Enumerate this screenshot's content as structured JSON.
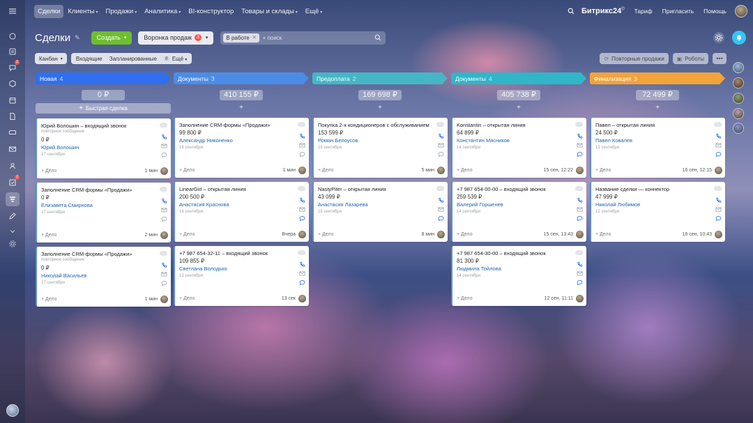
{
  "topnav": {
    "items": [
      {
        "label": "Сделки",
        "active": true,
        "caret": false
      },
      {
        "label": "Клиенты",
        "active": false,
        "caret": true
      },
      {
        "label": "Продажи",
        "active": false,
        "caret": true
      },
      {
        "label": "Аналитика",
        "active": false,
        "caret": true
      },
      {
        "label": "BI-конструктор",
        "active": false,
        "caret": false
      },
      {
        "label": "Товары и склады",
        "active": false,
        "caret": true
      },
      {
        "label": "Ещё",
        "active": false,
        "caret": true
      }
    ],
    "brand": "Битрикс24",
    "brand_mark": "©",
    "tariff": "Тариф",
    "invite": "Пригласить",
    "help": "Помощь"
  },
  "sidebar": {
    "badges": {
      "chat": "2",
      "tasks": "2"
    }
  },
  "header": {
    "title": "Сделки",
    "create_label": "Создать",
    "funnel_label": "Воронка продаж",
    "funnel_count": "3",
    "filter_chip": "В работе",
    "search_placeholder": "+ поиск"
  },
  "view": {
    "mode": "Канбан",
    "incoming": "Входящие",
    "planned": "Запланированные",
    "more_count": "8",
    "more_label": "Ещё",
    "repeat_sales": "Повторные продажи",
    "robots": "Роботы",
    "dots": "•••"
  },
  "deal_label": "+ Дело",
  "quick_deal": "Быстрая сделка",
  "columns": [
    {
      "name": "Новая",
      "count": "4",
      "sum": "0 ₽",
      "color": "#2f6ff0",
      "cards": [
        {
          "title": "Юрий Волошин – входящий звонок",
          "sub": "повторное сообщение",
          "amount": "0 ₽",
          "client": "Юрий Волошин",
          "date": "17 сентября",
          "time": "1 мин"
        },
        {
          "title": "Заполнение CRM-формы «Продажи»",
          "sub": "",
          "amount": "0 ₽",
          "client": "Елизавета Смирнова",
          "date": "17 сентября",
          "time": "2 мин"
        },
        {
          "title": "Заполнение CRM-формы «Продажи»",
          "sub": "повторное сообщение",
          "amount": "0 ₽",
          "client": "Николай Васильев",
          "date": "17 сентября",
          "time": "1 мин"
        }
      ]
    },
    {
      "name": "Документы",
      "count": "3",
      "sum": "410 155 ₽",
      "color": "#4b8de6",
      "cards": [
        {
          "title": "Заполнение CRM-формы «Продажи»",
          "sub": "",
          "amount": "99 800 ₽",
          "client": "Александр Никоненко",
          "date": "16 сентября",
          "time": "1 мин"
        },
        {
          "title": "LinearGirl – открытая линия",
          "sub": "",
          "amount": "200 500 ₽",
          "client": "Анастасия Краснова",
          "date": "16 сентября",
          "time": "Вчера"
        },
        {
          "title": "+7 987 654-32-11 – входящий звонок",
          "sub": "",
          "amount": "109 855 ₽",
          "client": "Светлана Володько",
          "date": "13 сентября",
          "time": "13 сек"
        }
      ]
    },
    {
      "name": "Предоплата",
      "count": "2",
      "sum": "169 698 ₽",
      "color": "#46b6c6",
      "cards": [
        {
          "title": "Покупка 2-х кондиционеров с обслуживанием",
          "sub": "",
          "amount": "153 599 ₽",
          "client": "Роман Белоусов",
          "date": "15 сентября",
          "time": "5 мин"
        },
        {
          "title": "NastyPiter – открытая линия",
          "sub": "",
          "amount": "43 099 ₽",
          "client": "Анастасия Лазарева",
          "date": "15 сентября",
          "time": "8 мин"
        }
      ]
    },
    {
      "name": "Документы",
      "count": "4",
      "sum": "405 738 ₽",
      "color": "#2fb6c8",
      "cards": [
        {
          "title": "Konstantin – открытая линия",
          "sub": "",
          "amount": "64 899 ₽",
          "client": "Константин Мясников",
          "date": "14 сентября",
          "time": "15 сен, 12:22"
        },
        {
          "title": "+7 987 654-00-00 – входящий звонок",
          "sub": "",
          "amount": "259 539 ₽",
          "client": "Валерий Горшенев",
          "date": "14 сентября",
          "time": "15 сен, 13:43"
        },
        {
          "title": "+7 987 654-30-00 – входящий звонок",
          "sub": "",
          "amount": "81 300 ₽",
          "client": "Людмила Тойлова",
          "date": "14 сентября",
          "time": "12 сен, 11:11"
        }
      ]
    },
    {
      "name": "Финализация",
      "count": "3",
      "sum": "72 499 ₽",
      "color": "#f2a43a",
      "cards": [
        {
          "title": "Павел – открытая линия",
          "sub": "",
          "amount": "24 500 ₽",
          "client": "Павел Ковалев",
          "date": "13 сентября",
          "time": "16 сен, 12:15"
        },
        {
          "title": "Название сделки — коннектор",
          "sub": "",
          "amount": "47 999 ₽",
          "client": "Николай Любимов",
          "date": "12 сентября",
          "time": "16 сен, 10:43"
        }
      ]
    }
  ]
}
